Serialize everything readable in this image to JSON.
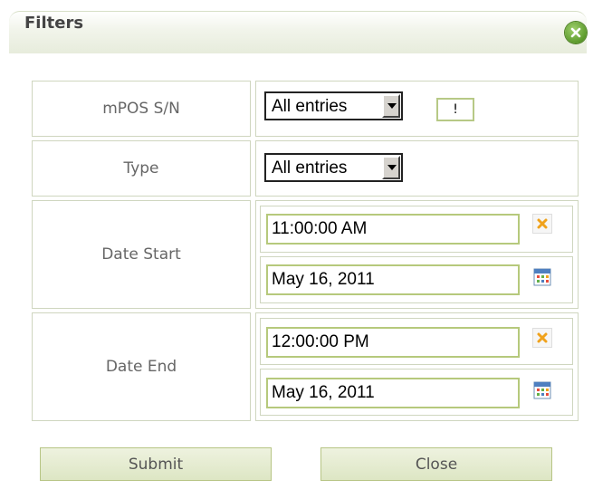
{
  "dialog": {
    "title": "Filters"
  },
  "filters": {
    "mpos": {
      "label": "mPOS S/N",
      "select_value": "All entries",
      "button_label": "!"
    },
    "type": {
      "label": "Type",
      "select_value": "All entries"
    },
    "date_start": {
      "label": "Date Start",
      "time": "11:00:00 AM",
      "date": "May 16, 2011"
    },
    "date_end": {
      "label": "Date End",
      "time": "12:00:00 PM",
      "date": "May 16, 2011"
    }
  },
  "actions": {
    "submit_label": "Submit",
    "close_label": "Close"
  },
  "icons": {
    "close_dialog": "close-icon",
    "clear": "clear-x-icon",
    "calendar": "calendar-icon"
  },
  "colors": {
    "accent": "#b6c97c",
    "close_green": "#5c9a2c",
    "clear_orange": "#f0a21c"
  }
}
